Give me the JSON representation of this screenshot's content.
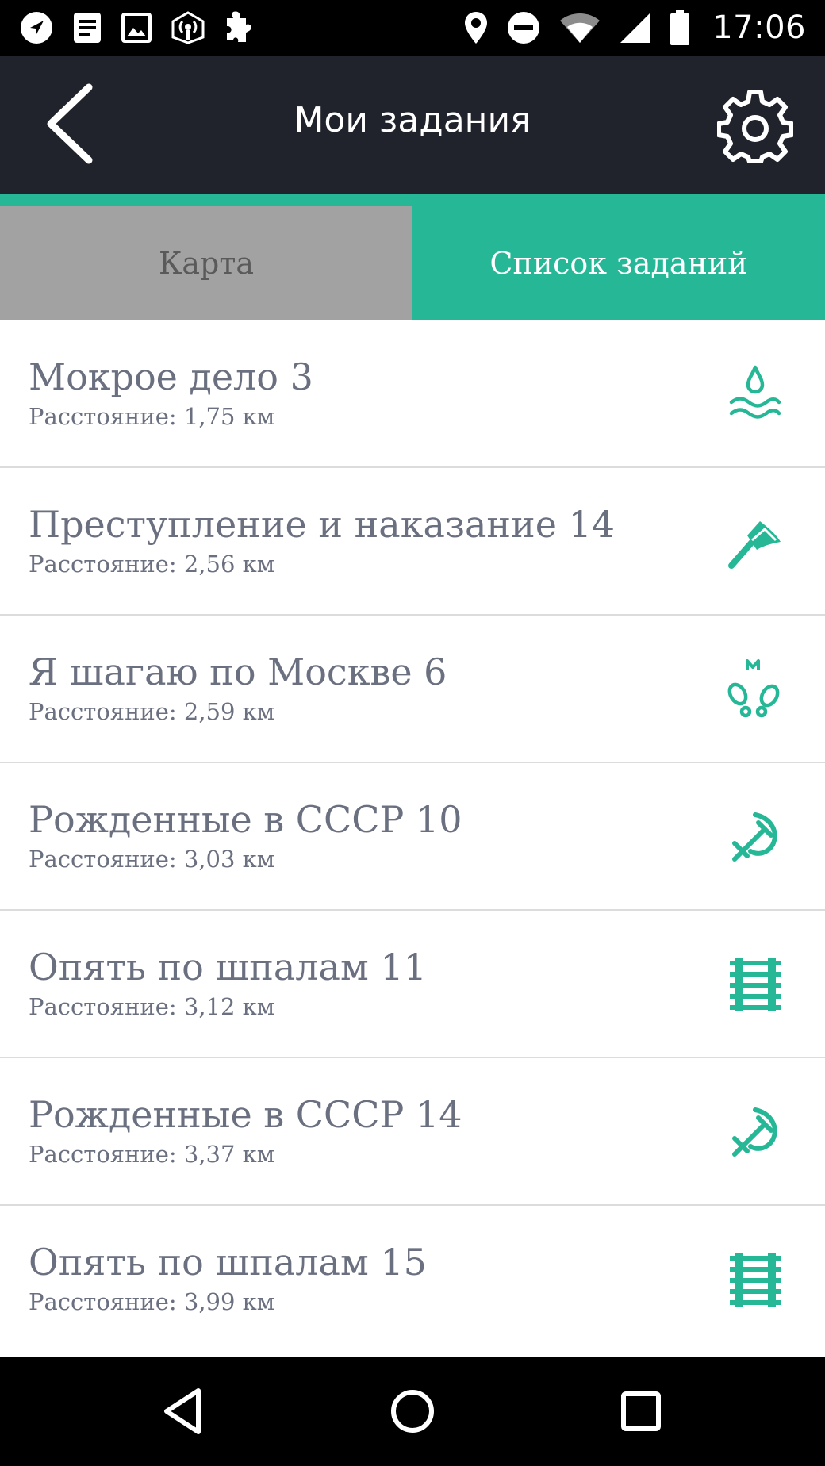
{
  "status_bar": {
    "time": "17:06",
    "left_icons": [
      "navigation-icon",
      "notes-icon",
      "image-icon",
      "broadcast-icon",
      "puzzle-icon"
    ],
    "right_icons": [
      "location-pin-icon",
      "do-not-disturb-icon",
      "wifi-icon",
      "cell-signal-icon",
      "battery-icon"
    ]
  },
  "header": {
    "title": "Мои задания",
    "back_icon": "chevron-left-icon",
    "settings_icon": "gear-icon"
  },
  "tabs": [
    {
      "label": "Карта",
      "active": false
    },
    {
      "label": "Список заданий",
      "active": true
    }
  ],
  "tasks": [
    {
      "title": "Мокрое дело 3",
      "distance": "Расстояние: 1,75 км",
      "icon": "water-drop-icon"
    },
    {
      "title": "Преступление и наказание 14",
      "distance": "Расстояние: 2,56 км",
      "icon": "axe-icon"
    },
    {
      "title": "Я шагаю по Москве 6",
      "distance": "Расстояние: 2,59 км",
      "icon": "footprints-metro-icon"
    },
    {
      "title": "Рожденные в СССР 10",
      "distance": "Расстояние: 3,03 км",
      "icon": "hammer-sickle-icon"
    },
    {
      "title": "Опять по шпалам 11",
      "distance": "Расстояние: 3,12 км",
      "icon": "railway-icon"
    },
    {
      "title": "Рожденные в СССР 14",
      "distance": "Расстояние: 3,37 км",
      "icon": "hammer-sickle-icon"
    },
    {
      "title": "Опять по шпалам 15",
      "distance": "Расстояние: 3,99 км",
      "icon": "railway-icon"
    }
  ],
  "nav_bar": {
    "icons": [
      "nav-back-icon",
      "nav-home-icon",
      "nav-recents-icon"
    ]
  },
  "colors": {
    "accent": "#26b896",
    "header_bg": "#20232b",
    "inactive_tab": "#a2a2a2",
    "text": "#6b7080"
  }
}
